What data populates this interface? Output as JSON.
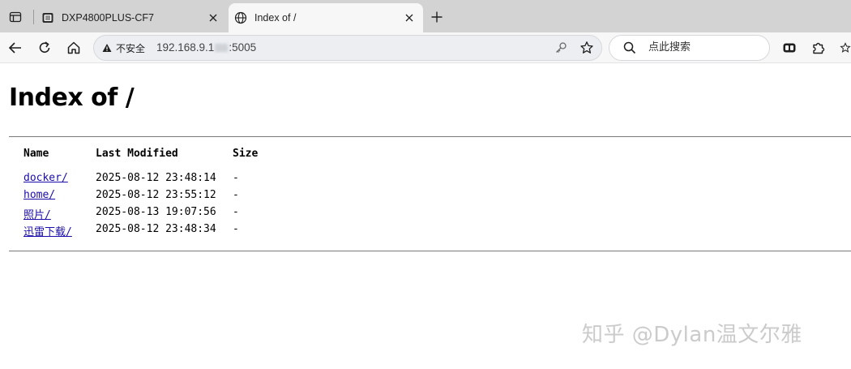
{
  "browser": {
    "tabs": [
      {
        "title": "DXP4800PLUS-CF7",
        "icon": "nas-device-icon",
        "active": false
      },
      {
        "title": "Index of /",
        "icon": "globe-icon",
        "active": true
      }
    ],
    "address": {
      "security_label": "不安全",
      "url_prefix": "192.168.9.1",
      "url_suffix": ":5005"
    },
    "search": {
      "placeholder": "点此搜索"
    }
  },
  "page": {
    "title": "Index of /",
    "columns": [
      "Name",
      "Last Modified",
      "Size"
    ],
    "entries": [
      {
        "name": "docker/",
        "modified": "2025-08-12 23:48:14",
        "size": "-"
      },
      {
        "name": "home/",
        "modified": "2025-08-12 23:55:12",
        "size": "-"
      },
      {
        "name": "照片/",
        "modified": "2025-08-13 19:07:56",
        "size": "-"
      },
      {
        "name": "迅雷下载/",
        "modified": "2025-08-12 23:48:34",
        "size": "-"
      }
    ]
  },
  "watermark": "知乎 @Dylan温文尔雅"
}
